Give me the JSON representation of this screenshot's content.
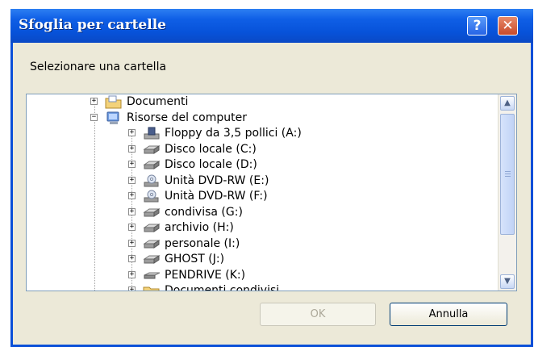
{
  "window": {
    "title": "Sfoglia per cartelle",
    "help_symbol": "?",
    "close_symbol": "✕"
  },
  "prompt": "Selezionare una cartella",
  "tree": {
    "items": [
      {
        "label": "Documenti",
        "icon": "documents-folder-icon",
        "level": 0
      },
      {
        "label": "Risorse del computer",
        "icon": "my-computer-icon",
        "level": 0
      },
      {
        "label": "Floppy da 3,5 pollici (A:)",
        "icon": "floppy-drive-icon",
        "level": 1
      },
      {
        "label": "Disco locale (C:)",
        "icon": "hard-disk-icon",
        "level": 1
      },
      {
        "label": "Disco locale (D:)",
        "icon": "hard-disk-icon",
        "level": 1
      },
      {
        "label": "Unità DVD-RW (E:)",
        "icon": "dvd-drive-icon",
        "level": 1
      },
      {
        "label": "Unità DVD-RW (F:)",
        "icon": "dvd-drive-icon",
        "level": 1
      },
      {
        "label": "condivisa (G:)",
        "icon": "hard-disk-icon",
        "level": 1
      },
      {
        "label": "archivio (H:)",
        "icon": "hard-disk-icon",
        "level": 1
      },
      {
        "label": "personale (I:)",
        "icon": "hard-disk-icon",
        "level": 1
      },
      {
        "label": "GHOST (J:)",
        "icon": "hard-disk-icon",
        "level": 1
      },
      {
        "label": "PENDRIVE (K:)",
        "icon": "removable-drive-icon",
        "level": 1
      },
      {
        "label": "Documenti condivisi",
        "icon": "shared-folder-icon",
        "level": 1
      }
    ]
  },
  "buttons": {
    "ok": "OK",
    "cancel": "Annulla"
  },
  "colors": {
    "titlebar": "#0752d9",
    "dialog_bg": "#ece9d8",
    "tree_border": "#7f9db9"
  }
}
